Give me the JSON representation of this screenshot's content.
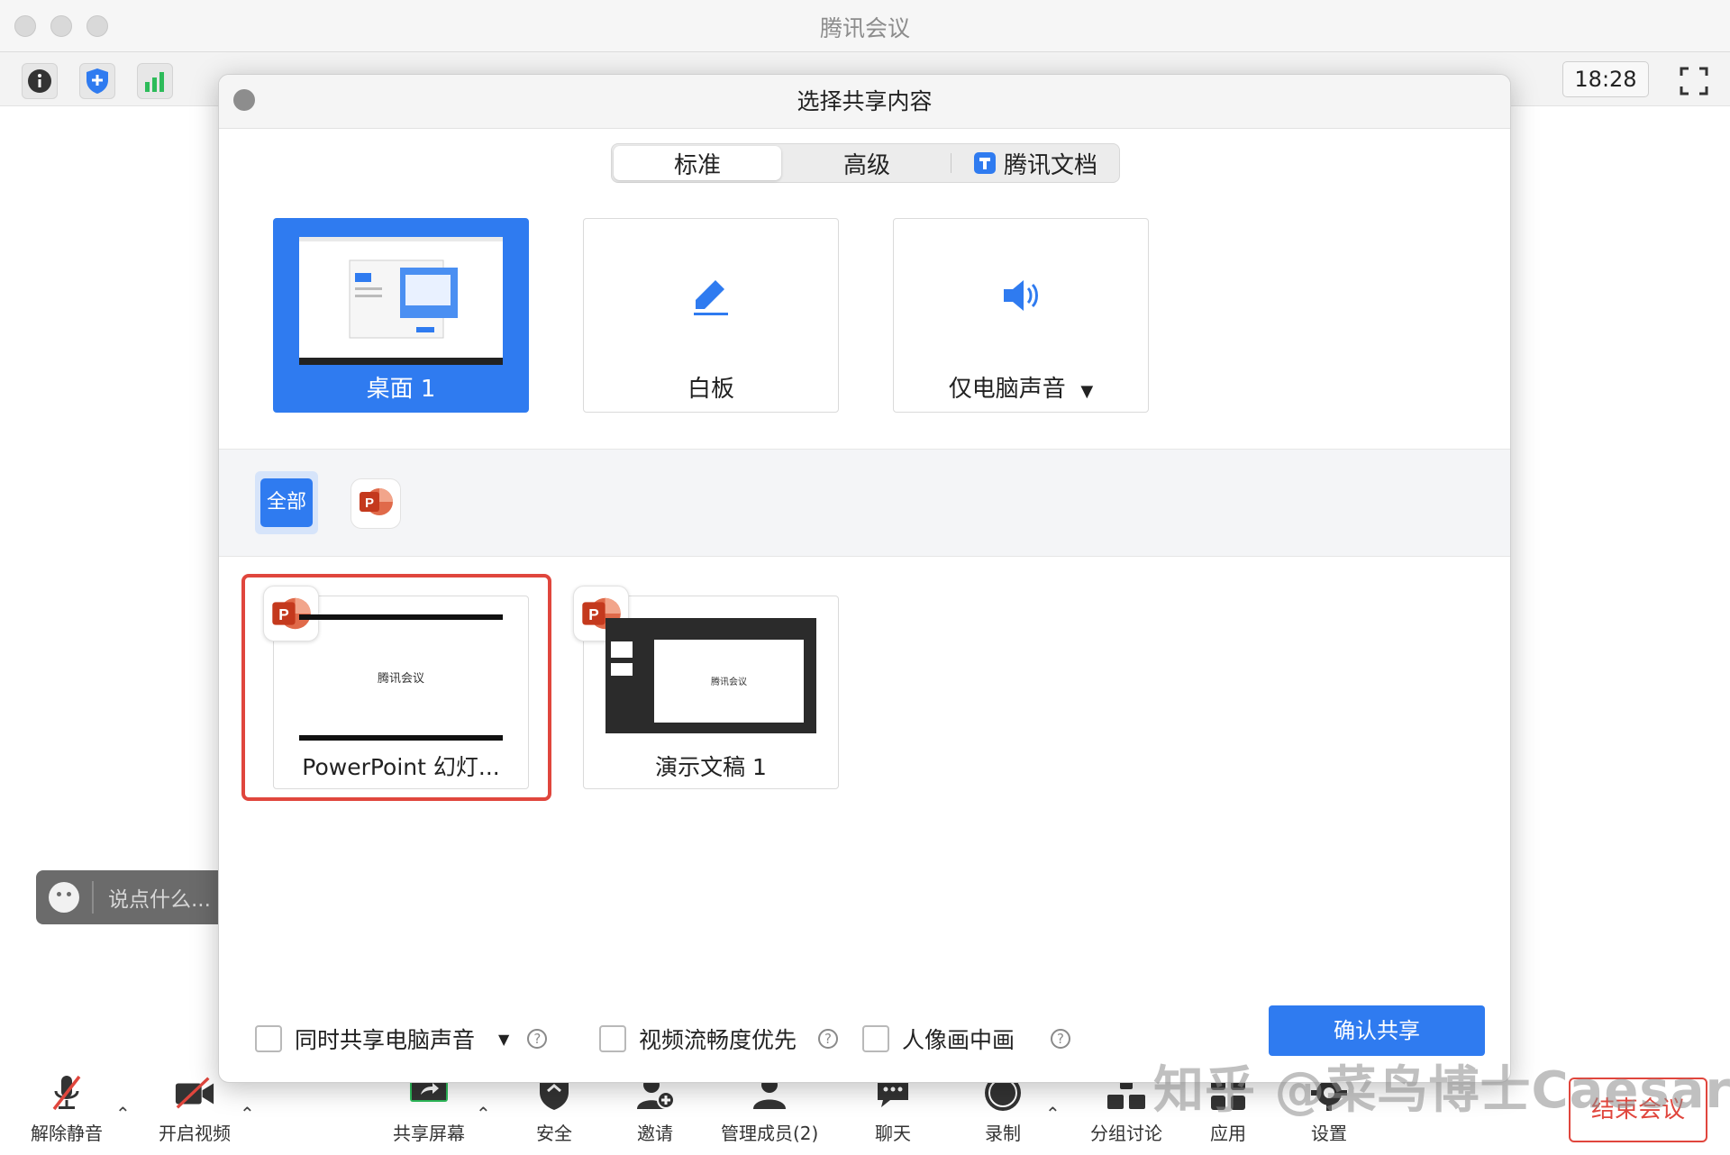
{
  "window": {
    "title": "腾讯会议"
  },
  "toolbar": {
    "clock": "18:28"
  },
  "chat": {
    "placeholder": "说点什么..."
  },
  "dialog": {
    "title": "选择共享内容",
    "tabs": [
      {
        "label": "标准",
        "active": true
      },
      {
        "label": "高级",
        "active": false
      },
      {
        "label": "腾讯文档",
        "active": false
      }
    ],
    "sources": [
      {
        "label": "桌面 1",
        "selected": true
      },
      {
        "label": "白板",
        "selected": false
      },
      {
        "label": "仅电脑声音",
        "selected": false
      }
    ],
    "filter": {
      "all_label": "全部"
    },
    "windows": [
      {
        "label": "PowerPoint 幻灯...",
        "thumb_text": "腾讯会议",
        "highlighted": true
      },
      {
        "label": "演示文稿 1",
        "thumb_text": "腾讯会议",
        "highlighted": false
      }
    ],
    "options": [
      {
        "label": "同时共享电脑声音",
        "checked": false
      },
      {
        "label": "视频流畅度优先",
        "checked": false
      },
      {
        "label": "人像画中画",
        "checked": false
      }
    ],
    "confirm_label": "确认共享"
  },
  "bottombar": {
    "items": [
      {
        "label": "解除静音"
      },
      {
        "label": "开启视频"
      },
      {
        "label": "共享屏幕"
      },
      {
        "label": "安全"
      },
      {
        "label": "邀请"
      },
      {
        "label": "管理成员(2)"
      },
      {
        "label": "聊天"
      },
      {
        "label": "录制"
      },
      {
        "label": "分组讨论"
      },
      {
        "label": "应用"
      },
      {
        "label": "设置"
      }
    ],
    "end_label": "结束会议"
  },
  "watermark": "知乎 @菜鸟博士Caesar",
  "colors": {
    "accent": "#2f7bf0",
    "danger": "#e0463d",
    "ppt": "#d24726"
  }
}
